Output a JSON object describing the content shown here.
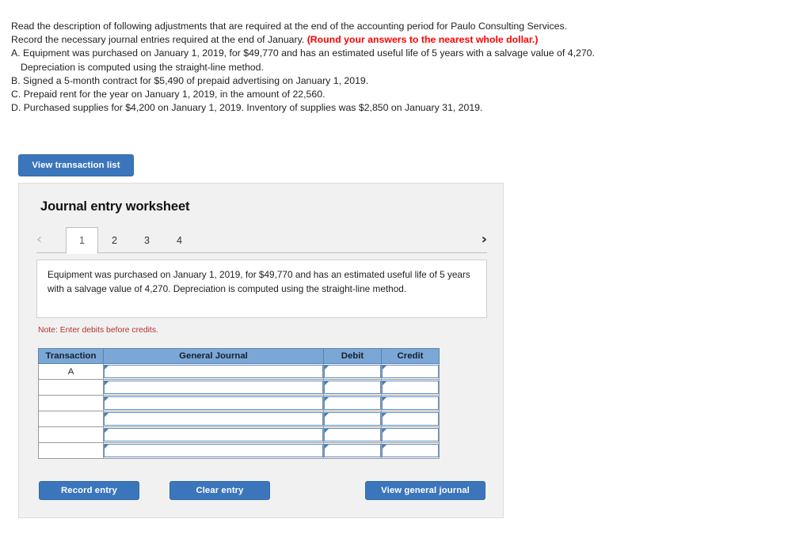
{
  "problem": {
    "line1": "Read the description of following adjustments that are required at the end of the accounting period for Paulo Consulting Services.",
    "line2_prefix": "Record the necessary journal entries required at the end of January. ",
    "line2_emphasis": "(Round your answers to the nearest whole dollar.)",
    "item_a_1": "A. Equipment was purchased on January 1, 2019, for $49,770 and has an estimated useful life of 5 years with a salvage value of 4,270.",
    "item_a_2": "Depreciation is computed using the straight-line method.",
    "item_b": "B. Signed a 5-month contract for $5,490 of prepaid advertising on January 1, 2019.",
    "item_c": "C. Prepaid rent for the year on January 1, 2019, in the amount of 22,560.",
    "item_d": "D. Purchased supplies for $4,200 on January 1, 2019. Inventory of supplies was $2,850 on January 31, 2019."
  },
  "view_transaction_list_label": "View transaction list",
  "worksheet": {
    "title": "Journal entry worksheet",
    "prev_icon": "‹",
    "next_icon": "›",
    "tabs": [
      {
        "label": "1",
        "active": true
      },
      {
        "label": "2",
        "active": false
      },
      {
        "label": "3",
        "active": false
      },
      {
        "label": "4",
        "active": false
      }
    ],
    "description": "Equipment was purchased on January 1, 2019, for $49,770 and has an estimated useful life of 5 years with a salvage value of 4,270. Depreciation is computed using the straight-line method.",
    "note": "Note: Enter debits before credits.",
    "table": {
      "headers": [
        "Transaction",
        "General Journal",
        "Debit",
        "Credit"
      ],
      "rows": [
        {
          "transaction": "A",
          "general_journal": "",
          "debit": "",
          "credit": ""
        },
        {
          "transaction": "",
          "general_journal": "",
          "debit": "",
          "credit": ""
        },
        {
          "transaction": "",
          "general_journal": "",
          "debit": "",
          "credit": ""
        },
        {
          "transaction": "",
          "general_journal": "",
          "debit": "",
          "credit": ""
        },
        {
          "transaction": "",
          "general_journal": "",
          "debit": "",
          "credit": ""
        },
        {
          "transaction": "",
          "general_journal": "",
          "debit": "",
          "credit": ""
        }
      ]
    },
    "buttons": {
      "record": "Record entry",
      "clear": "Clear entry",
      "view_journal": "View general journal"
    }
  },
  "colors": {
    "button_blue": "#3b76bd",
    "table_header_blue": "#7ba7d7",
    "emphasis_red": "#ff0000",
    "note_red": "#b5332f",
    "panel_gray": "#f1f1f1"
  }
}
